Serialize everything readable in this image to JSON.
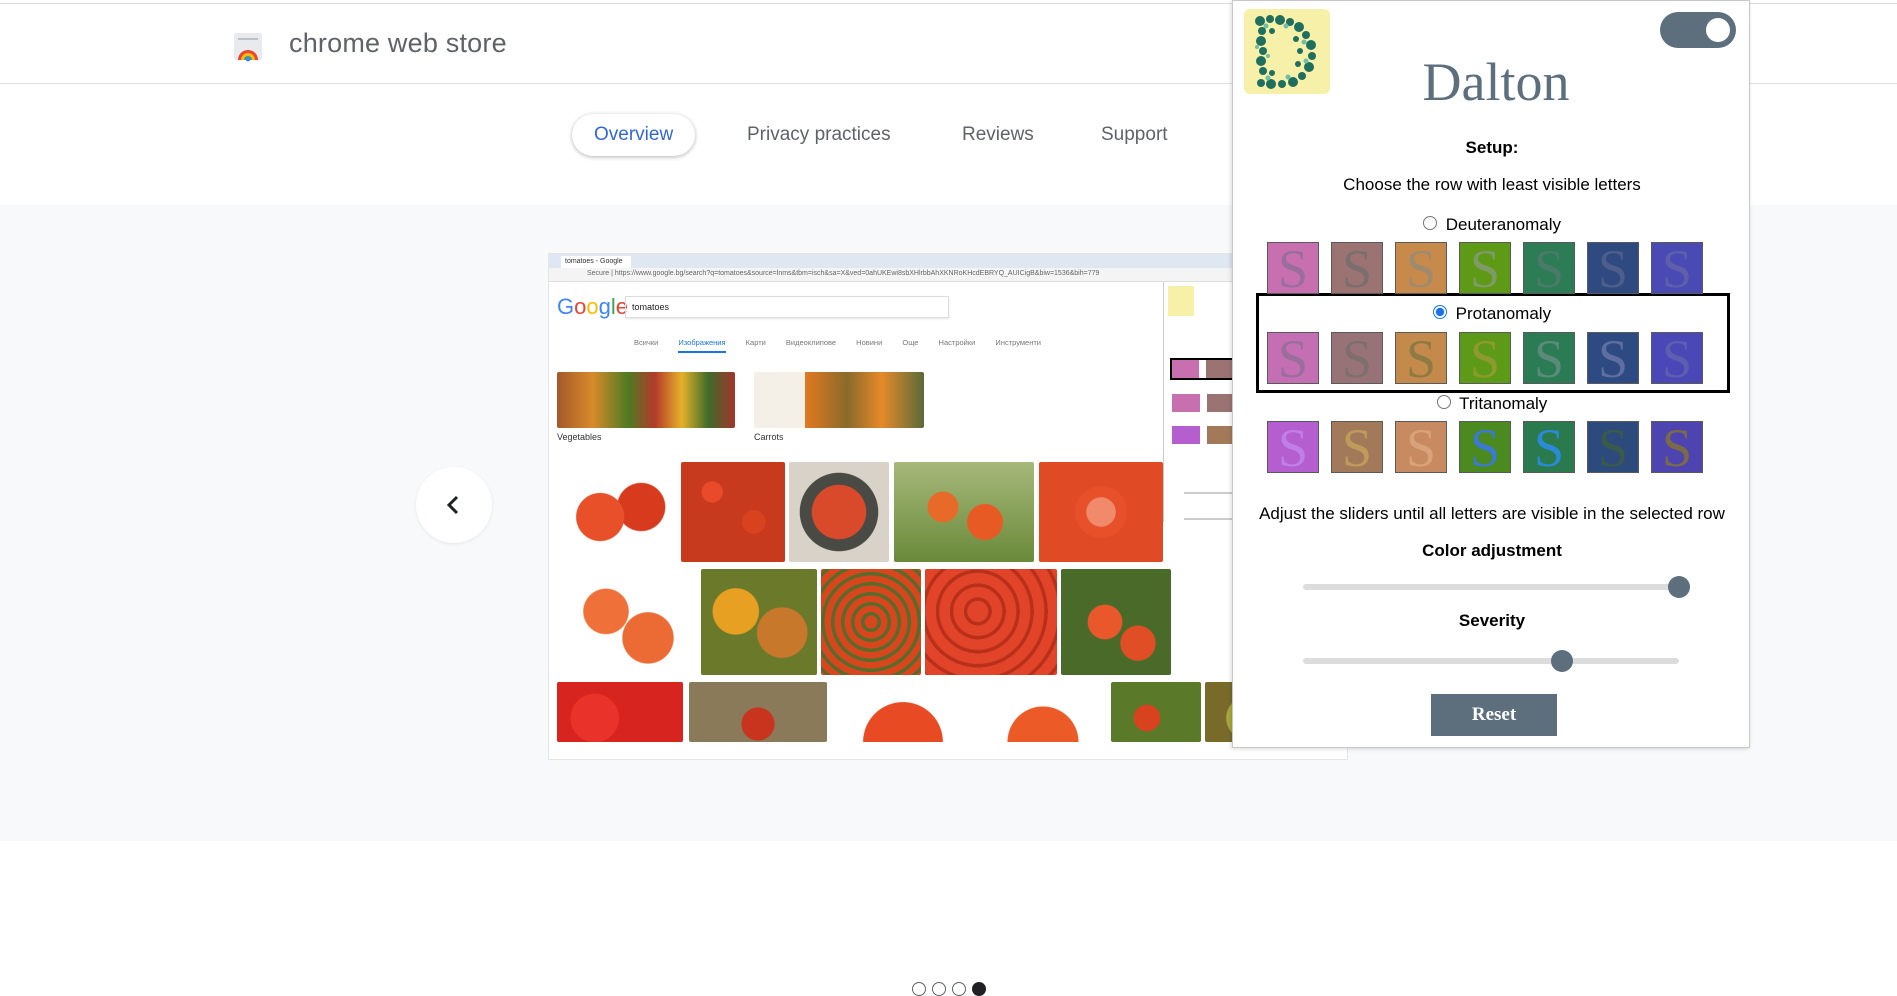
{
  "store": {
    "title": "chrome web store"
  },
  "tabs": [
    {
      "label": "Overview",
      "active": true
    },
    {
      "label": "Privacy practices",
      "active": false
    },
    {
      "label": "Reviews",
      "active": false
    },
    {
      "label": "Support",
      "active": false
    }
  ],
  "screenshot": {
    "browser_tab": "tomatoes - Google Търс...",
    "url": "Secure | https://www.google.bg/search?q=tomatoes&source=lnms&tbm=isch&sa=X&ved=0ahUKEwi8sbXHlrbbAhXKNRoKHcdEBRYQ_AUICigB&biw=1536&bih=779",
    "search_query": "tomatoes",
    "categories": [
      "Всички",
      "Изображения",
      "Карти",
      "Видеоклипове",
      "Новини",
      "Още",
      "Настройки",
      "Инструменти"
    ],
    "active_category": "Изображения",
    "related": [
      "Vegetables",
      "Carrots"
    ]
  },
  "carousel": {
    "total": 4,
    "current": 4
  },
  "popup": {
    "logo_letter": "D",
    "title": "Dalton",
    "setup_label": "Setup:",
    "instruction": "Choose the row with least visible letters",
    "swatch_letter": "S",
    "rows": [
      {
        "label": "Deuteranomaly",
        "selected": false,
        "colors": [
          "#c86fb0",
          "#9b7373",
          "#c88a4a",
          "#5f9a16",
          "#2c7d55",
          "#2e4a80",
          "#4a4ab4"
        ],
        "letter_colors": [
          "#9a6e9a",
          "#7a6e6e",
          "#9e8a6e",
          "#7e9a66",
          "#4c7a6a",
          "#4e5e8a",
          "#5e5eaa"
        ]
      },
      {
        "label": "Protanomaly",
        "selected": true,
        "colors": [
          "#c46fb4",
          "#977377",
          "#c38a4c",
          "#5c9a17",
          "#2b7c55",
          "#2d4a82",
          "#4a48b6"
        ],
        "letter_colors": [
          "#9a6e9a",
          "#7e6e6e",
          "#8e7a44",
          "#8e9a2e",
          "#5c8a7a",
          "#5e6ea0",
          "#5e5eb0"
        ]
      },
      {
        "label": "Tritanomaly",
        "selected": false,
        "colors": [
          "#b45ed0",
          "#a27a5a",
          "#c88a60",
          "#4a8a1e",
          "#2a7a4e",
          "#2c4a7c",
          "#4e44b0"
        ],
        "letter_colors": [
          "#c07ee8",
          "#c09a5a",
          "#d8a27a",
          "#3a7ad0",
          "#2a8ad8",
          "#3a5a4a",
          "#7a6a48"
        ]
      }
    ],
    "adjust_text": "Adjust the sliders until all letters are visible in the selected row",
    "color_adjustment_label": "Color adjustment",
    "color_adjustment_value": 1.0,
    "severity_label": "Severity",
    "severity_value": 0.69,
    "reset_label": "Reset",
    "toggle_on": true
  },
  "colors": {
    "accent": "#5d6e7d",
    "tab_active": "#3367d6",
    "logo_bg": "#f6f0a8"
  }
}
